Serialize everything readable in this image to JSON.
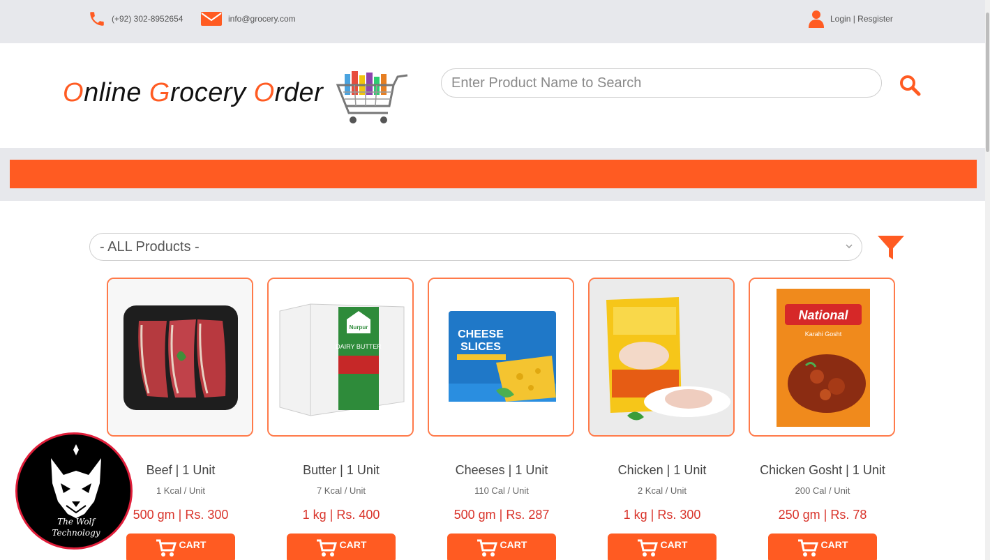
{
  "colors": {
    "accent": "#ff5b22",
    "price": "#d9342b",
    "topbar": "#e7e8ec"
  },
  "topbar": {
    "phone": "(+92) 302-8952654",
    "email": "info@grocery.com",
    "login": "Login | Resgister",
    "phone_icon": "phone-icon",
    "email_icon": "envelope-icon",
    "user_icon": "user-icon"
  },
  "header": {
    "logo_parts": [
      "O",
      "nline ",
      "G",
      "rocery ",
      "O",
      "rder"
    ],
    "search_placeholder": "Enter Product Name to Search",
    "search_icon": "search-icon"
  },
  "filter": {
    "selected": "- ALL Products -",
    "filter_icon": "funnel-icon"
  },
  "products": [
    {
      "name": "Beef | 1 Unit",
      "cal": "1 Kcal / Unit",
      "price": "500 gm | Rs. 300",
      "button": "CART"
    },
    {
      "name": "Butter | 1 Unit",
      "cal": "7 Kcal / Unit",
      "price": "1 kg | Rs. 400",
      "button": "CART"
    },
    {
      "name": "Cheeses | 1 Unit",
      "cal": "110 Cal / Unit",
      "price": "500 gm | Rs. 287",
      "button": "CART"
    },
    {
      "name": "Chicken | 1 Unit",
      "cal": "2 Kcal / Unit",
      "price": "1 kg | Rs. 300",
      "button": "CART"
    },
    {
      "name": "Chicken Gosht | 1 Unit",
      "cal": "200 Cal / Unit",
      "price": "250 gm | Rs. 78",
      "button": "CART"
    }
  ],
  "package_labels": {
    "butter_brand": "Nurpur",
    "butter_label": "DAIRY BUTTER",
    "cheese_label_1": "CHEESE",
    "cheese_label_2": "SLICES",
    "gosht_brand": "National",
    "gosht_label": "Karahi Gosht"
  },
  "watermark": {
    "line1": "The Wolf",
    "line2": "Technology"
  }
}
